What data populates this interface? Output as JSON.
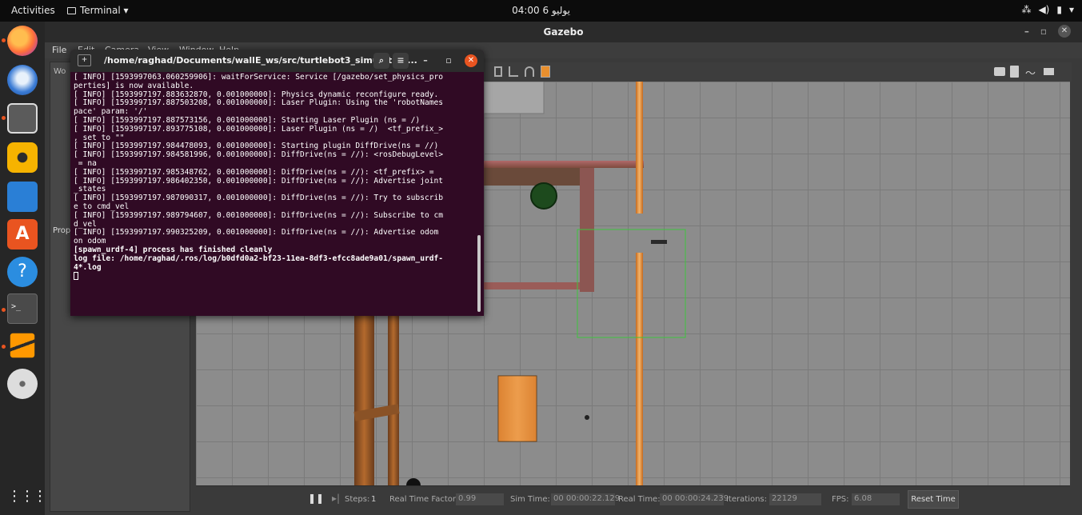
{
  "topbar": {
    "activities": "Activities",
    "app_menu": "Terminal ▾",
    "clock": "04:00 6 يوليو",
    "tray_network": "⁂",
    "tray_volume": "◀)",
    "tray_battery": "▮",
    "tray_menu": "▾"
  },
  "gazebo": {
    "title": "Gazebo",
    "menus": [
      "File",
      "Edit",
      "Camera",
      "View",
      "Window",
      "Help"
    ],
    "left_panel_headers": [
      "Wo",
      "Prop"
    ],
    "bottom": {
      "steps_label": "Steps:",
      "steps_value": "1",
      "rtf_label": "Real Time Factor:",
      "rtf_value": "0.99",
      "sim_label": "Sim Time:",
      "sim_value": "00 00:00:22.129",
      "real_label": "Real Time:",
      "real_value": "00 00:00:24.239",
      "iter_label": "Iterations:",
      "iter_value": "22129",
      "fps_label": "FPS:",
      "fps_value": "6.08",
      "reset": "Reset Time"
    }
  },
  "terminal": {
    "title": "/home/raghad/Documents/wallE_ws/src/turtlebot3_simulation...",
    "lines": [
      "[ INFO] [1593997063.060259906]: waitForService: Service [/gazebo/set_physics_pro",
      "perties] is now available.",
      "[ INFO] [1593997197.883632870, 0.001000000]: Physics dynamic reconfigure ready.",
      "[ INFO] [1593997197.887503208, 0.001000000]: Laser Plugin: Using the 'robotNames",
      "pace' param: '/'",
      "[ INFO] [1593997197.887573156, 0.001000000]: Starting Laser Plugin (ns = /)",
      "[ INFO] [1593997197.893775108, 0.001000000]: Laser Plugin (ns = /)  <tf_prefix_>",
      ", set to \"\"",
      "[ INFO] [1593997197.984478093, 0.001000000]: Starting plugin DiffDrive(ns = //)",
      "[ INFO] [1593997197.984581996, 0.001000000]: DiffDrive(ns = //): <rosDebugLevel>",
      " = na",
      "[ INFO] [1593997197.985348762, 0.001000000]: DiffDrive(ns = //): <tf_prefix> =",
      "[ INFO] [1593997197.986402350, 0.001000000]: DiffDrive(ns = //): Advertise joint",
      "_states",
      "[ INFO] [1593997197.987090317, 0.001000000]: DiffDrive(ns = //): Try to subscrib",
      "e to cmd_vel",
      "[ INFO] [1593997197.989794607, 0.001000000]: DiffDrive(ns = //): Subscribe to cm",
      "d_vel",
      "[ INFO] [1593997197.990325209, 0.001000000]: DiffDrive(ns = //): Advertise odom",
      "on odom"
    ],
    "bold_lines": [
      "[spawn_urdf-4] process has finished cleanly",
      "log file: /home/raghad/.ros/log/b0dfd0a2-bf23-11ea-8df3-efcc8ade9a01/spawn_urdf-",
      "4*.log"
    ]
  },
  "dock": {
    "items": [
      "firefox-icon",
      "thunderbird-icon",
      "files-icon",
      "rhythmbox-icon",
      "writer-icon",
      "software-icon",
      "help-icon",
      "terminal-icon",
      "sublime-icon",
      "disc-icon"
    ],
    "apps_grid": "⋮⋮⋮"
  }
}
